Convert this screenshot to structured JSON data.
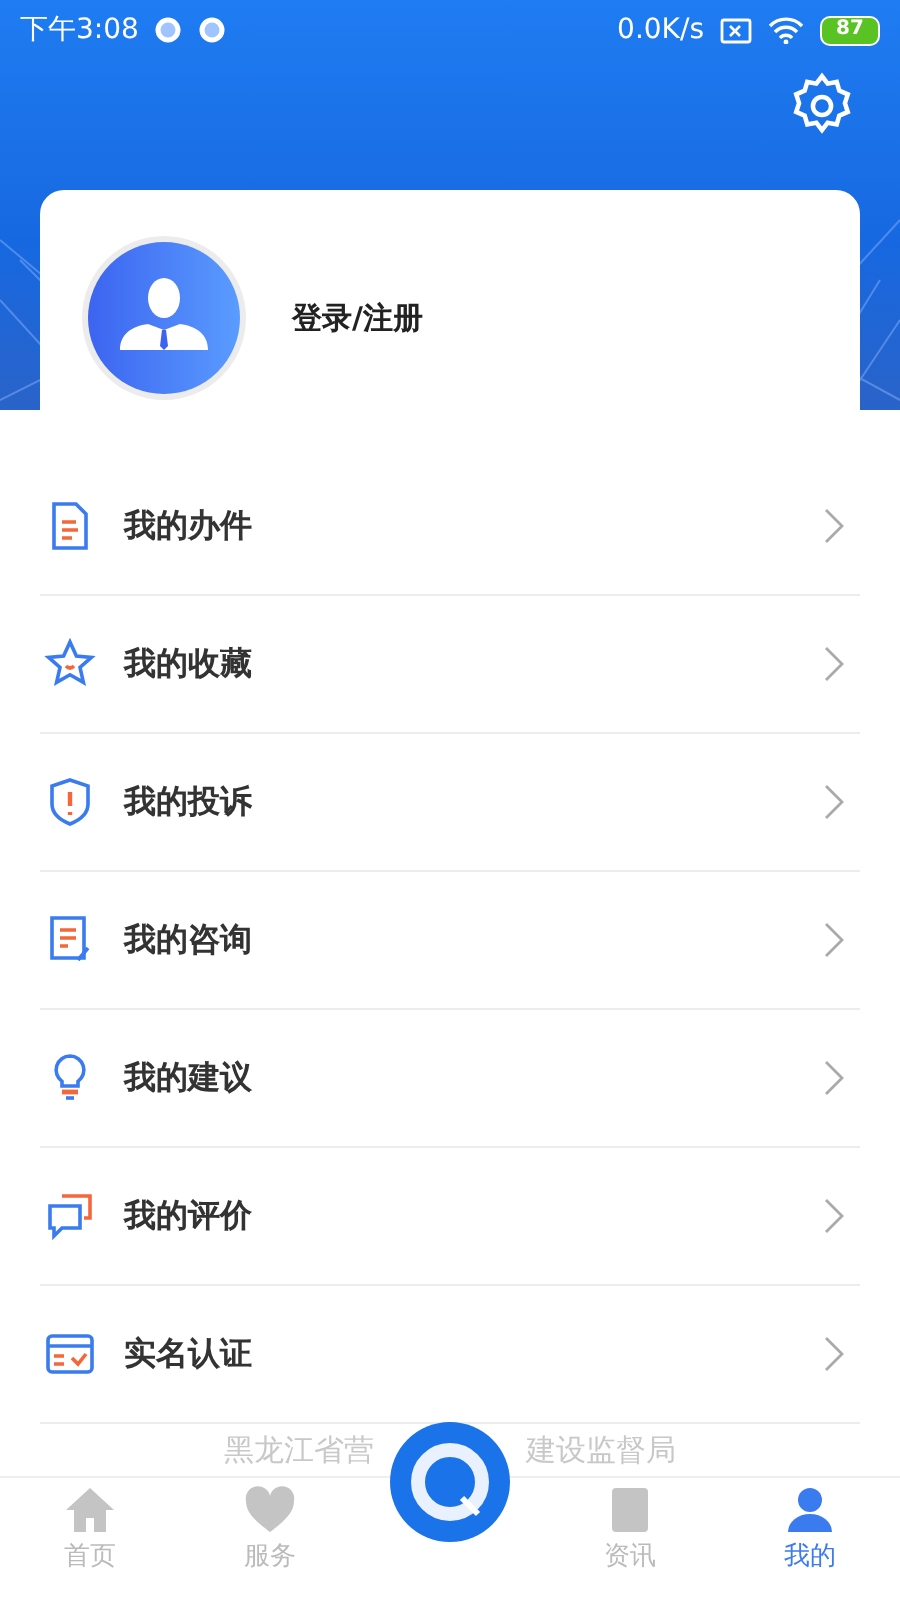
{
  "status_bar": {
    "time": "下午3:08",
    "speed": "0.0K/s",
    "battery": "87"
  },
  "profile": {
    "login_label": "登录/注册"
  },
  "menu": [
    {
      "label": "我的办件",
      "kind": "document"
    },
    {
      "label": "我的收藏",
      "kind": "star"
    },
    {
      "label": "我的投诉",
      "kind": "shield"
    },
    {
      "label": "我的咨询",
      "kind": "form"
    },
    {
      "label": "我的建议",
      "kind": "bulb"
    },
    {
      "label": "我的评价",
      "kind": "chat"
    },
    {
      "label": "实名认证",
      "kind": "card"
    }
  ],
  "footer": {
    "left": "黑龙江省营",
    "right": "建设监督局"
  },
  "nav": [
    {
      "kind": "home",
      "label": "首页",
      "selected": false
    },
    {
      "kind": "heart",
      "label": "服务",
      "selected": false
    },
    {
      "kind": "logo"
    },
    {
      "kind": "news",
      "label": "资讯",
      "selected": false
    },
    {
      "kind": "person",
      "label": "我的",
      "selected": true
    }
  ]
}
